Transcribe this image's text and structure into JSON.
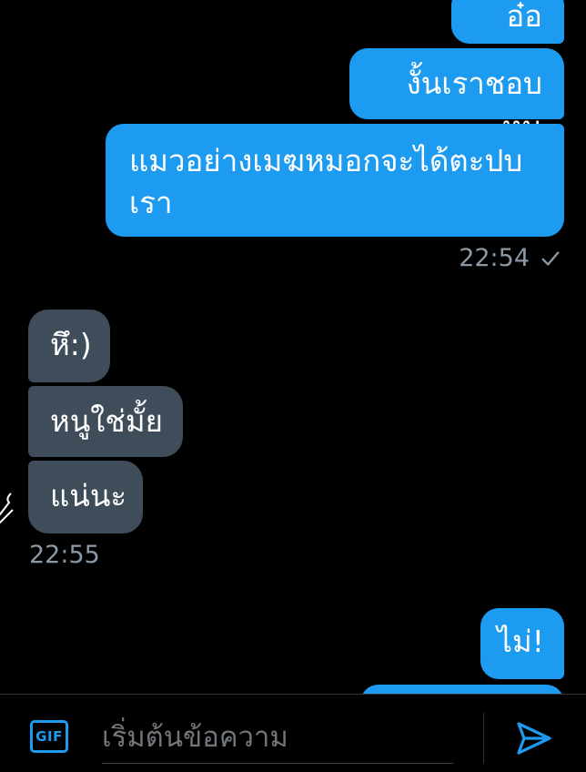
{
  "colors": {
    "outgoing_bubble": "#1d9bf0",
    "incoming_bubble": "#3f4d5a",
    "timestamp": "#8b98a5",
    "accent": "#1d9bf0",
    "background": "#000000"
  },
  "conversation": {
    "outgoing_group_1": {
      "messages": [
        {
          "text": "อ๋ออว"
        },
        {
          "text": "งั้นเราชอบหนู"
        },
        {
          "text": "แมวอย่างเมฆหมอกจะได้ตะปบ\nเรา"
        }
      ],
      "timestamp": "22:54",
      "status_icon": "check-icon"
    },
    "incoming_group_1": {
      "messages": [
        {
          "text": "หึ:)"
        },
        {
          "text": "หนูใช่มั้ย"
        },
        {
          "text": "แน่นะ"
        }
      ],
      "timestamp": "22:55"
    },
    "outgoing_group_2": {
      "messages": [
        {
          "text": "ไม่!"
        },
        {
          "text": ""
        }
      ]
    }
  },
  "composer": {
    "gif_label": "GIF",
    "placeholder": "เริ่มต้นข้อความ",
    "send_icon": "send-icon"
  }
}
